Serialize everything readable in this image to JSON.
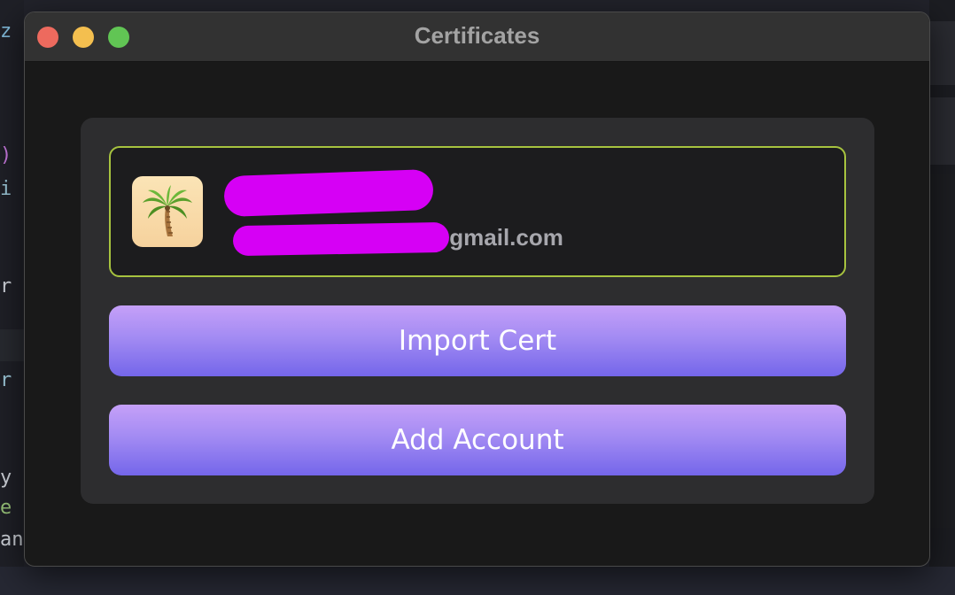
{
  "window": {
    "title": "Certificates"
  },
  "background_code": {
    "glyphs": [
      "z",
      ")",
      "i",
      "r",
      "r",
      "y",
      "e",
      "an"
    ]
  },
  "account": {
    "avatar_icon": "palm-tree-icon",
    "email_visible_suffix": "gmail.com"
  },
  "buttons": {
    "import_label": "Import Cert",
    "add_label": "Add Account"
  },
  "colors": {
    "accent_border": "#a7c33f",
    "button_top": "#c5a0f8",
    "button_bottom": "#7466ea",
    "redaction": "#d600f5"
  }
}
